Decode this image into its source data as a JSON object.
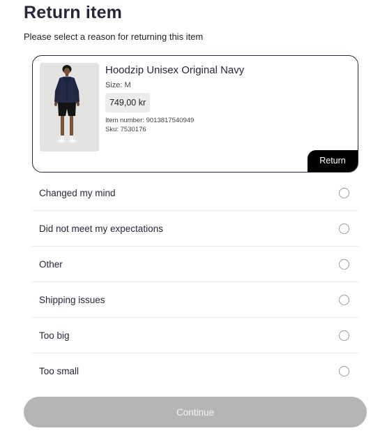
{
  "header": {
    "title": "Return item",
    "subtitle": "Please select a reason for returning this item"
  },
  "item": {
    "name": "Hoodzip Unisex Original Navy",
    "size": "Size: M",
    "price": "749,00 kr",
    "item_number": "Item number: 9013817540949",
    "sku": "Sku: 7530176",
    "return_label": "Return",
    "thumbnail_icon": "product-photo-person-in-navy-hoodie"
  },
  "reasons": [
    {
      "label": "Changed my mind",
      "selected": false
    },
    {
      "label": "Did not meet my expectations",
      "selected": false
    },
    {
      "label": "Other",
      "selected": false
    },
    {
      "label": "Shipping issues",
      "selected": false
    },
    {
      "label": "Too big",
      "selected": false
    },
    {
      "label": "Too small",
      "selected": false
    }
  ],
  "footer": {
    "continue_label": "Continue",
    "continue_enabled": false
  },
  "colors": {
    "text_dark": "#2a2538",
    "card_border": "#2a2538",
    "return_tag_bg": "#000000",
    "button_disabled_bg": "#b5b5b5",
    "divider": "#ececec"
  }
}
